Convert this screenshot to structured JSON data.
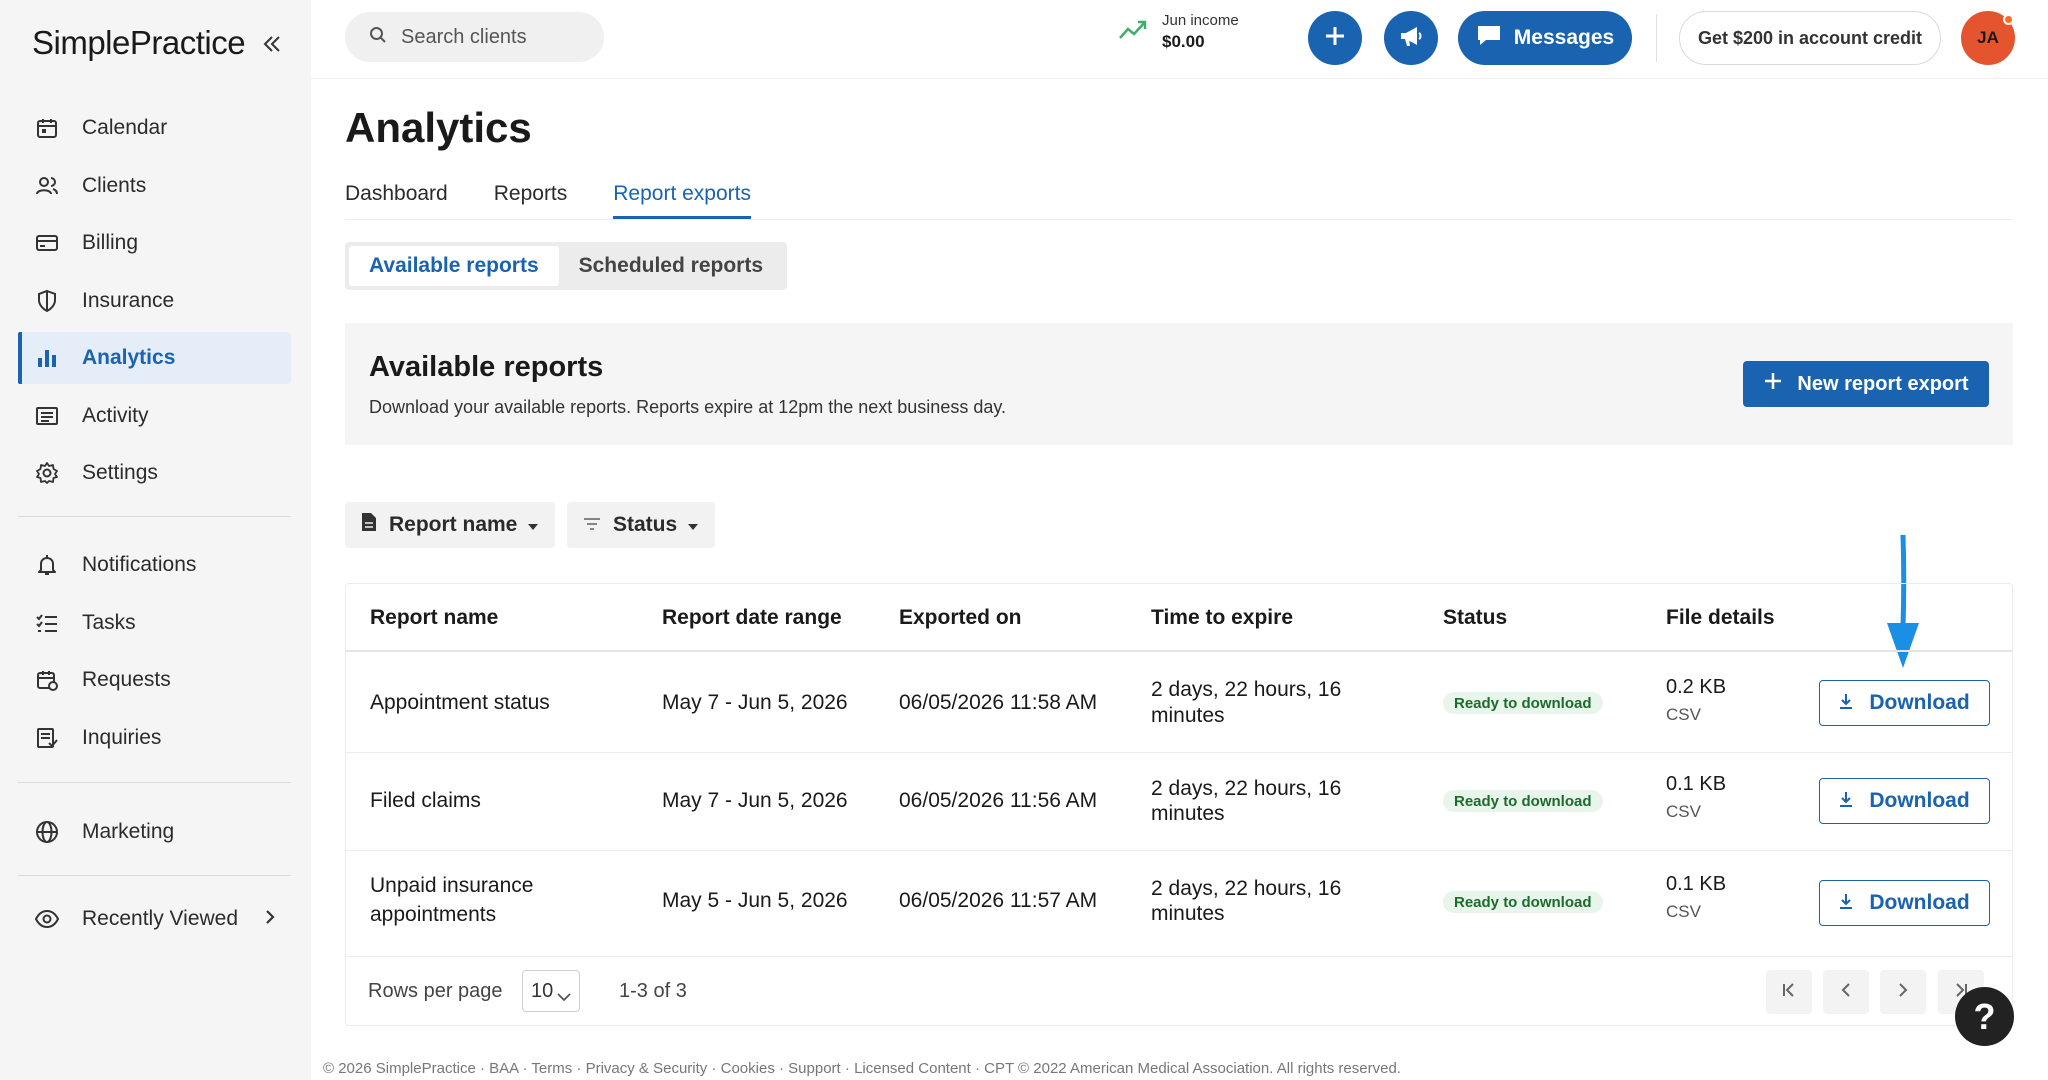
{
  "brand": {
    "logo_text": "SimplePractice"
  },
  "sidebar": {
    "items": [
      {
        "label": "Calendar"
      },
      {
        "label": "Clients"
      },
      {
        "label": "Billing"
      },
      {
        "label": "Insurance"
      },
      {
        "label": "Analytics"
      },
      {
        "label": "Activity"
      },
      {
        "label": "Settings"
      },
      {
        "label": "Notifications"
      },
      {
        "label": "Tasks"
      },
      {
        "label": "Requests"
      },
      {
        "label": "Inquiries"
      },
      {
        "label": "Marketing"
      },
      {
        "label": "Recently Viewed"
      }
    ],
    "active": "Analytics"
  },
  "topbar": {
    "search_placeholder": "Search clients",
    "income_label": "Jun income",
    "income_value": "$0.00",
    "messages_label": "Messages",
    "credit_label": "Get $200 in account credit",
    "avatar_initials": "JA"
  },
  "main": {
    "title": "Analytics",
    "tabs": [
      {
        "label": "Dashboard"
      },
      {
        "label": "Reports"
      },
      {
        "label": "Report exports"
      }
    ],
    "active_tab": "Report exports",
    "segments": [
      {
        "label": "Available reports"
      },
      {
        "label": "Scheduled reports"
      }
    ],
    "banner": {
      "heading": "Available reports",
      "description": "Download your available reports. Reports expire at 12pm the next business day.",
      "new_export_label": "New report export"
    },
    "filters": [
      {
        "label": "Report name"
      },
      {
        "label": "Status"
      }
    ],
    "table": {
      "headers": [
        "Report name",
        "Report date range",
        "Exported on",
        "Time to expire",
        "Status",
        "File details"
      ],
      "rows": [
        {
          "name": "Appointment status",
          "range": "May 7 - Jun 5, 2026",
          "exported": "06/05/2026 11:58 AM",
          "expire_1": "2 days, 22 hours, 16",
          "expire_2": "minutes",
          "status": "Ready to download",
          "size": "0.2 KB",
          "type": "CSV",
          "action": "Download"
        },
        {
          "name": "Filed claims",
          "range": "May 7 - Jun 5, 2026",
          "exported": "06/05/2026 11:56 AM",
          "expire_1": "2 days, 22 hours, 16",
          "expire_2": "minutes",
          "status": "Ready to download",
          "size": "0.1 KB",
          "type": "CSV",
          "action": "Download"
        },
        {
          "name_1": "Unpaid insurance",
          "name_2": "appointments",
          "range": "May 5 - Jun 5, 2026",
          "exported": "06/05/2026 11:57 AM",
          "expire_1": "2 days, 22 hours, 16",
          "expire_2": "minutes",
          "status": "Ready to download",
          "size": "0.1 KB",
          "type": "CSV",
          "action": "Download"
        }
      ],
      "rows_per_page_label": "Rows per page",
      "rows_per_page_value": "10",
      "range_text": "1-3 of 3"
    }
  },
  "help_label": "?",
  "footer": {
    "copyright": "© 2026 SimplePractice",
    "links": [
      "BAA",
      "Terms",
      "Privacy & Security",
      "Cookies",
      "Support",
      "Licensed Content"
    ],
    "cpt": "CPT © 2022 American Medical Association. All rights reserved."
  },
  "colors": {
    "accent": "#1963b1",
    "success_bg": "#e8f5ea",
    "success_text": "#1e6b2e",
    "avatar": "#e4552f"
  },
  "icons": [
    "calendar-icon",
    "clients-icon",
    "billing-icon",
    "insurance-icon",
    "analytics-icon",
    "activity-icon",
    "settings-icon",
    "notifications-icon",
    "tasks-icon",
    "requests-icon",
    "inquiries-icon",
    "marketing-icon",
    "recently-viewed-icon",
    "search-icon",
    "trend-icon",
    "plus-icon",
    "megaphone-icon",
    "chat-icon",
    "download-icon",
    "document-icon",
    "filter-icon",
    "help-icon",
    "blue-arrow-annotation"
  ]
}
